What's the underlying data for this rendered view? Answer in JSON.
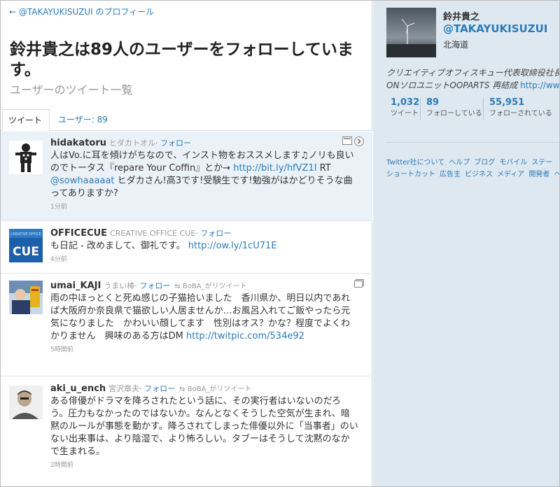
{
  "header": {
    "back_link": "← @TAKAYUKISUZUI のプロフィール",
    "title": "鈴井貴之は89人のユーザーをフォローしています。",
    "subtitle": "ユーザーのツイート一覧"
  },
  "tabs": [
    {
      "label": "ツイート"
    },
    {
      "label": "ユーザー: 89"
    }
  ],
  "tweets": [
    {
      "user": "hidakatoru",
      "name": "ヒダカトオル",
      "follow": "· フォロー",
      "retweet": "",
      "text_parts": [
        {
          "t": "人はVo.に耳を傾けがちなので、インスト物をおススメします♫ノリも良いのでトータス『repare Your Coffin』とか→ ",
          "link": false
        },
        {
          "t": "http://bit.ly/hfVZ1I",
          "link": true
        },
        {
          "t": " RT ",
          "link": false
        },
        {
          "t": "@sowhaaaaat",
          "link": true
        },
        {
          "t": " ヒダカさん!高3です!受験生です!勉強がはかどりそうな曲ってありますか?",
          "link": false
        }
      ],
      "time": "1分前"
    },
    {
      "user": "OFFICECUE",
      "name": "CREATIVE OFFICE CUE",
      "follow": "· フォロー",
      "retweet": "",
      "text_parts": [
        {
          "t": "も日記 - 改めまして、御礼です。 ",
          "link": false
        },
        {
          "t": "http://ow.ly/1cU71E",
          "link": true
        }
      ],
      "time": "4分前"
    },
    {
      "user": "umai_KAJI",
      "name": "うまい棒",
      "follow": "· フォロー",
      "retweet": "BoBA_がリツイート",
      "text_parts": [
        {
          "t": "雨の中ほっとくと死ぬ感じの子猫拾いました　香川県か、明日以内であれば大阪府か奈良県で猫欲しい人居ませんか…お風呂入れてご飯やったら元気になりました　かわいい顔してます　性別はオス？かな？程度でよくわかりません　興味のある方はDM ",
          "link": false
        },
        {
          "t": "http://twitpic.com/534e92",
          "link": true
        }
      ],
      "time": "5時間前"
    },
    {
      "user": "aki_u_ench",
      "name": "宮沢章夫",
      "follow": "· フォロー",
      "retweet": "BoBA_がリツイート",
      "text_parts": [
        {
          "t": "ある俳優がドラマを降ろされたという話に、その実行者はいないのだろう。圧力もなかったのではないか。なんとなくそうした空気が生まれ、暗黙のルールが事態を動かす。降ろされてしまった俳優以外に「当事者」のいない出来事は、より陰湿で、より怖ろしい。タブーはそうして沈黙のなかで生まれる。",
          "link": false
        }
      ],
      "time": "2時間前"
    }
  ],
  "profile": {
    "name": "鈴井貴之",
    "handle": "@TAKAYUKISUZUI",
    "location": "北海道",
    "bio_line1": "クリエイティブオフィスキュー代表取締役社長",
    "bio_line2_text": "ONソロユニットOOPARTS 再結成 ",
    "bio_line2_link": "http://www.",
    "stats": [
      {
        "num": "1,032",
        "label": "ツイート"
      },
      {
        "num": "89",
        "label": "フォローしている"
      },
      {
        "num": "55,951",
        "label": "フォローされている"
      }
    ]
  },
  "footer": {
    "row1": [
      "Twitter社について",
      "ヘルプ",
      "ブログ",
      "モバイル",
      "ステー"
    ],
    "row2": [
      "ショートカット",
      "広告主",
      "ビジネス",
      "メディア",
      "開発者",
      "ヘ"
    ]
  },
  "colors": {
    "link": "#2b7bb9",
    "sidebar_bg": "#dde8f0",
    "highlight_bg": "#eaf2f8"
  }
}
